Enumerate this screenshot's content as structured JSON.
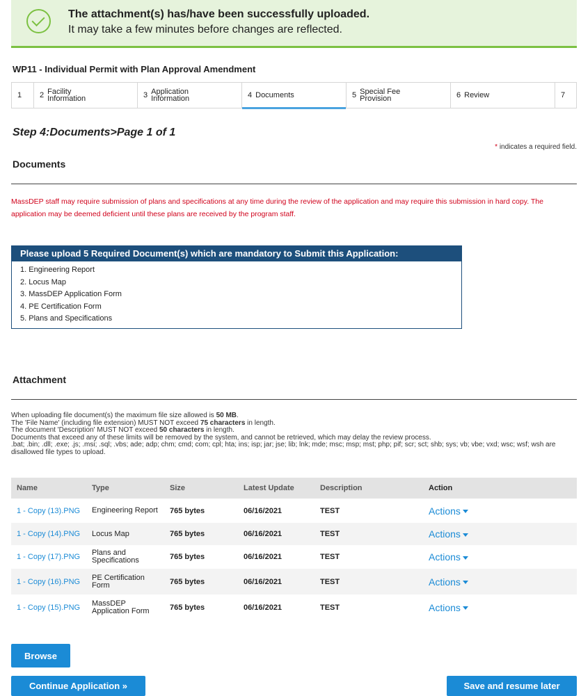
{
  "banner": {
    "title": "The attachment(s) has/have been successfully uploaded.",
    "subtitle": "It may take a few minutes before changes are reflected.",
    "icon": "check-circle-icon"
  },
  "permit_title": "WP11 - Individual Permit with Plan Approval Amendment",
  "steps": [
    {
      "num": "1",
      "label": ""
    },
    {
      "num": "2",
      "label": "Facility Information"
    },
    {
      "num": "3",
      "label": "Application Information"
    },
    {
      "num": "4",
      "label": "Documents",
      "active": true
    },
    {
      "num": "5",
      "label": "Special Fee Provision"
    },
    {
      "num": "6",
      "label": "Review"
    },
    {
      "num": "7",
      "label": ""
    }
  ],
  "step_heading": "Step 4:Documents>Page 1 of 1",
  "required_note": {
    "star": "*",
    "text": "indicates a required field."
  },
  "documents_title": "Documents",
  "red_notice": "MassDEP staff may require submission of plans and specifications at any time during the review of the application and may require this submission in hard copy. The application may be deemed deficient until these plans are received by the program staff.",
  "upload_box": {
    "header": "Please upload 5 Required Document(s) which are mandatory to Submit this Application:",
    "items": [
      "1. Engineering Report",
      "2. Locus Map",
      "3. MassDEP Application Form",
      "4. PE Certification Form",
      "5. Plans and Specifications"
    ]
  },
  "attachment_title": "Attachment",
  "info": {
    "line1_pre": "When uploading file document(s) the maximum file size allowed is ",
    "line1_bold": "50 MB",
    "line1_post": ".",
    "line2_pre": "The 'File Name' (including file extension) MUST NOT exceed ",
    "line2_bold": "75 characters",
    "line2_post": " in length.",
    "line3_pre": "The document 'Description' MUST NOT exceed ",
    "line3_bold": "50 characters",
    "line3_post": " in length.",
    "line4": "Documents that exceed any of these limits will be removed by the system, and cannot be retrieved, which may delay the review process.",
    "line5": ".bat; .bin; .dll; .exe; .js; .msi; .sql; .vbs; ade; adp; chm; cmd; com; cpl; hta; ins; isp; jar; jse; lib; lnk; mde; msc; msp; mst; php; pif; scr; sct; shb; sys; vb; vbe; vxd; wsc; wsf; wsh are disallowed file types to upload."
  },
  "table": {
    "headers": {
      "name": "Name",
      "type": "Type",
      "size": "Size",
      "latest": "Latest Update",
      "description": "Description",
      "action": "Action"
    },
    "rows": [
      {
        "name": "1 - Copy (13).PNG",
        "type": "Engineering Report",
        "size": "765 bytes",
        "date": "06/16/2021",
        "desc": "TEST",
        "action": "Actions"
      },
      {
        "name": "1 - Copy (14).PNG",
        "type": "Locus Map",
        "size": "765 bytes",
        "date": "06/16/2021",
        "desc": "TEST",
        "action": "Actions"
      },
      {
        "name": "1 - Copy (17).PNG",
        "type": "Plans and Specifications",
        "size": "765 bytes",
        "date": "06/16/2021",
        "desc": "TEST",
        "action": "Actions"
      },
      {
        "name": "1 - Copy (16).PNG",
        "type": "PE Certification Form",
        "size": "765 bytes",
        "date": "06/16/2021",
        "desc": "TEST",
        "action": "Actions"
      },
      {
        "name": "1 - Copy (15).PNG",
        "type": "MassDEP Application Form",
        "size": "765 bytes",
        "date": "06/16/2021",
        "desc": "TEST",
        "action": "Actions"
      }
    ]
  },
  "buttons": {
    "browse": "Browse",
    "continue": "Continue Application »",
    "save": "Save and resume later"
  },
  "colors": {
    "accent": "#1b8bd6",
    "success": "#7cc142",
    "header_navy": "#1d4f7c",
    "warning_red": "#d0021b"
  }
}
